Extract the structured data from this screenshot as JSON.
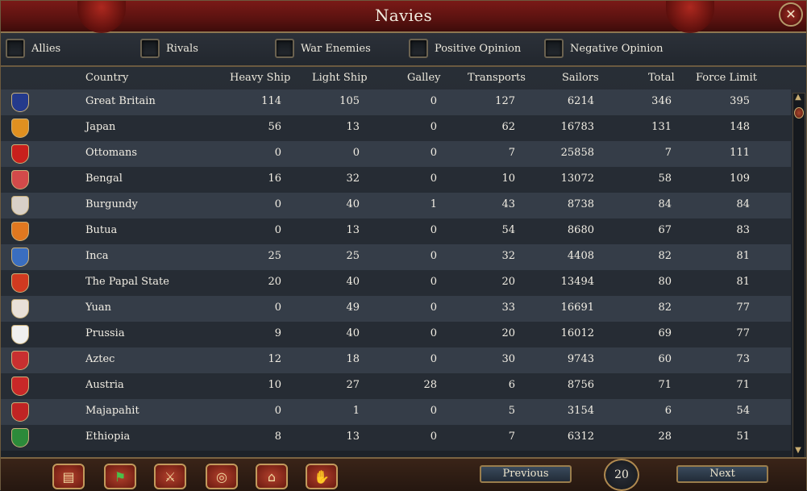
{
  "window": {
    "title": "Navies",
    "close_glyph": "✕"
  },
  "filters": [
    {
      "label": "Allies",
      "checked": false
    },
    {
      "label": "Rivals",
      "checked": false
    },
    {
      "label": "War Enemies",
      "checked": false
    },
    {
      "label": "Positive Opinion",
      "checked": false
    },
    {
      "label": "Negative Opinion",
      "checked": false
    }
  ],
  "table": {
    "columns": [
      "Country",
      "Heavy Ship",
      "Light Ship",
      "Galley",
      "Transports",
      "Sailors",
      "Total",
      "Force Limit"
    ],
    "rows": [
      {
        "flag_color": "#243a8c",
        "country": "Great Britain",
        "heavy": "114",
        "light": "105",
        "galley": "0",
        "transports": "127",
        "sailors": "6214",
        "total": "346",
        "force_limit": "395"
      },
      {
        "flag_color": "#e09020",
        "country": "Japan",
        "heavy": "56",
        "light": "13",
        "galley": "0",
        "transports": "62",
        "sailors": "16783",
        "total": "131",
        "force_limit": "148"
      },
      {
        "flag_color": "#c8201c",
        "country": "Ottomans",
        "heavy": "0",
        "light": "0",
        "galley": "0",
        "transports": "7",
        "sailors": "25858",
        "total": "7",
        "force_limit": "111"
      },
      {
        "flag_color": "#d24a4a",
        "country": "Bengal",
        "heavy": "16",
        "light": "32",
        "galley": "0",
        "transports": "10",
        "sailors": "13072",
        "total": "58",
        "force_limit": "109"
      },
      {
        "flag_color": "#d8d0c8",
        "country": "Burgundy",
        "heavy": "0",
        "light": "40",
        "galley": "1",
        "transports": "43",
        "sailors": "8738",
        "total": "84",
        "force_limit": "84"
      },
      {
        "flag_color": "#e07820",
        "country": "Butua",
        "heavy": "0",
        "light": "13",
        "galley": "0",
        "transports": "54",
        "sailors": "8680",
        "total": "67",
        "force_limit": "83"
      },
      {
        "flag_color": "#3a6ec0",
        "country": "Inca",
        "heavy": "25",
        "light": "25",
        "galley": "0",
        "transports": "32",
        "sailors": "4408",
        "total": "82",
        "force_limit": "81"
      },
      {
        "flag_color": "#d03a20",
        "country": "The Papal State",
        "heavy": "20",
        "light": "40",
        "galley": "0",
        "transports": "20",
        "sailors": "13494",
        "total": "80",
        "force_limit": "81"
      },
      {
        "flag_color": "#e8e0d8",
        "country": "Yuan",
        "heavy": "0",
        "light": "49",
        "galley": "0",
        "transports": "33",
        "sailors": "16691",
        "total": "82",
        "force_limit": "77"
      },
      {
        "flag_color": "#f0f0f0",
        "country": "Prussia",
        "heavy": "9",
        "light": "40",
        "galley": "0",
        "transports": "20",
        "sailors": "16012",
        "total": "69",
        "force_limit": "77"
      },
      {
        "flag_color": "#c83030",
        "country": "Aztec",
        "heavy": "12",
        "light": "18",
        "galley": "0",
        "transports": "30",
        "sailors": "9743",
        "total": "60",
        "force_limit": "73"
      },
      {
        "flag_color": "#c82828",
        "country": "Austria",
        "heavy": "10",
        "light": "27",
        "galley": "28",
        "transports": "6",
        "sailors": "8756",
        "total": "71",
        "force_limit": "71"
      },
      {
        "flag_color": "#c02424",
        "country": "Majapahit",
        "heavy": "0",
        "light": "1",
        "galley": "0",
        "transports": "5",
        "sailors": "3154",
        "total": "6",
        "force_limit": "54"
      },
      {
        "flag_color": "#2c8a3a",
        "country": "Ethiopia",
        "heavy": "8",
        "light": "13",
        "galley": "0",
        "transports": "7",
        "sailors": "6312",
        "total": "28",
        "force_limit": "51"
      }
    ]
  },
  "bottom_bar": {
    "buttons": [
      {
        "name": "ledger-icon",
        "glyph": "▤"
      },
      {
        "name": "green-flag-icon",
        "glyph": "⚑"
      },
      {
        "name": "crossed-swords-icon",
        "glyph": "⚔"
      },
      {
        "name": "coins-icon",
        "glyph": "◎"
      },
      {
        "name": "buildings-icon",
        "glyph": "⌂"
      },
      {
        "name": "handshake-icon",
        "glyph": "✋"
      }
    ],
    "previous_label": "Previous",
    "page_number": "20",
    "next_label": "Next"
  }
}
